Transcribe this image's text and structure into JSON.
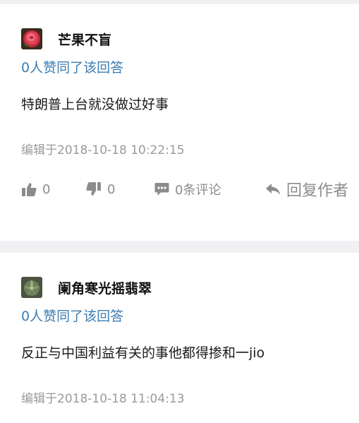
{
  "answers": [
    {
      "author": "芒果不盲",
      "avatar_icon": "red-rose-avatar",
      "likes_text": "0人赞同了该回答",
      "content": "特朗普上台就没做过好事",
      "edited": "编辑于2018-10-18 10:22:15",
      "actions": {
        "upvote_count": "0",
        "downvote_count": "0",
        "comments": "0条评论",
        "reply": "回复作者"
      }
    },
    {
      "author": "阑角寒光摇翡翠",
      "avatar_icon": "succulent-avatar",
      "likes_text": "0人赞同了该回答",
      "content": "反正与中国利益有关的事他都得掺和一jio",
      "edited": "编辑于2018-10-18 11:04:13"
    }
  ],
  "colors": {
    "link_blue": "#3e7cb1",
    "meta_gray": "#9a9a9a",
    "separator": "#f0f0f2"
  }
}
